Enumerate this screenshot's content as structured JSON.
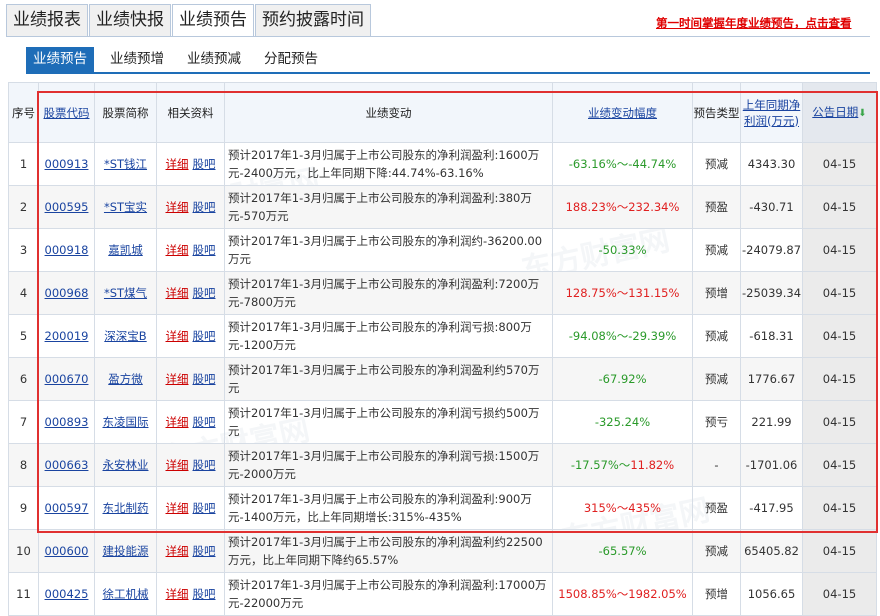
{
  "top_tabs": [
    "业绩报表",
    "业绩快报",
    "业绩预告",
    "预约披露时间"
  ],
  "top_tabs_active": 2,
  "promo_link": "第一时间掌握年度业绩预告，点击查看",
  "sub_tabs": [
    "业绩预告",
    "业绩预增",
    "业绩预减",
    "分配预告"
  ],
  "sub_tabs_active": 0,
  "headers": {
    "index": "序号",
    "code": "股票代码",
    "name": "股票简称",
    "resources": "相关资料",
    "change": "业绩变动",
    "range": "业绩变动幅度",
    "type": "预告类型",
    "profit": "上年同期净利润(万元)",
    "date": "公告日期"
  },
  "resource_labels": {
    "detail": "详细",
    "bar": "股吧"
  },
  "watermark": "东方财富网",
  "rows": [
    {
      "idx": "1",
      "code": "000913",
      "name": "*ST钱江",
      "change": "预计2017年1-3月归属于上市公司股东的净利润盈利:1600万元-2400万元，比上年同期下降:44.74%-63.16%",
      "range": "-63.16%～-44.74%",
      "dir": "down",
      "type": "预减",
      "profit": "4343.30",
      "date": "04-15"
    },
    {
      "idx": "2",
      "code": "000595",
      "name": "*ST宝实",
      "change": "预计2017年1-3月归属于上市公司股东的净利润盈利:380万元-570万元",
      "range": "188.23%～232.34%",
      "dir": "up",
      "type": "预盈",
      "profit": "-430.71",
      "date": "04-15"
    },
    {
      "idx": "3",
      "code": "000918",
      "name": "嘉凯城",
      "change": "预计2017年1-3月归属于上市公司股东的净利润约-36200.00万元",
      "range": "-50.33%",
      "dir": "down",
      "type": "预减",
      "profit": "-24079.87",
      "date": "04-15"
    },
    {
      "idx": "4",
      "code": "000968",
      "name": "*ST煤气",
      "change": "预计2017年1-3月归属于上市公司股东的净利润盈利:7200万元-7800万元",
      "range": "128.75%～131.15%",
      "dir": "up",
      "type": "预增",
      "profit": "-25039.34",
      "date": "04-15"
    },
    {
      "idx": "5",
      "code": "200019",
      "name": "深深宝B",
      "change": "预计2017年1-3月归属于上市公司股东的净利润亏损:800万元-1200万元",
      "range": "-94.08%～-29.39%",
      "dir": "down",
      "type": "预减",
      "profit": "-618.31",
      "date": "04-15"
    },
    {
      "idx": "6",
      "code": "000670",
      "name": "盈方微",
      "change": "预计2017年1-3月归属于上市公司股东的净利润盈利约570万元",
      "range": "-67.92%",
      "dir": "down",
      "type": "预减",
      "profit": "1776.67",
      "date": "04-15"
    },
    {
      "idx": "7",
      "code": "000893",
      "name": "东凌国际",
      "change": "预计2017年1-3月归属于上市公司股东的净利润亏损约500万元",
      "range": "-325.24%",
      "dir": "down",
      "type": "预亏",
      "profit": "221.99",
      "date": "04-15"
    },
    {
      "idx": "8",
      "code": "000663",
      "name": "永安林业",
      "change": "预计2017年1-3月归属于上市公司股东的净利润亏损:1500万元-2000万元",
      "range": "-17.57%～11.82%",
      "dir": "mixed",
      "range_a": "-17.57%～",
      "range_b": "11.82%",
      "type": "-",
      "profit": "-1701.06",
      "date": "04-15"
    },
    {
      "idx": "9",
      "code": "000597",
      "name": "东北制药",
      "change": "预计2017年1-3月归属于上市公司股东的净利润盈利:900万元-1400万元，比上年同期增长:315%-435%",
      "range": "315%～435%",
      "dir": "up",
      "type": "预盈",
      "profit": "-417.95",
      "date": "04-15"
    },
    {
      "idx": "10",
      "code": "000600",
      "name": "建投能源",
      "change": "预计2017年1-3月归属于上市公司股东的净利润盈利约22500万元，比上年同期下降约65.57%",
      "range": "-65.57%",
      "dir": "down",
      "type": "预减",
      "profit": "65405.82",
      "date": "04-15"
    },
    {
      "idx": "11",
      "code": "000425",
      "name": "徐工机械",
      "change": "预计2017年1-3月归属于上市公司股东的净利润盈利:17000万元-22000万元",
      "range": "1508.85%～1982.05%",
      "dir": "up",
      "type": "预增",
      "profit": "1056.65",
      "date": "04-15"
    }
  ]
}
